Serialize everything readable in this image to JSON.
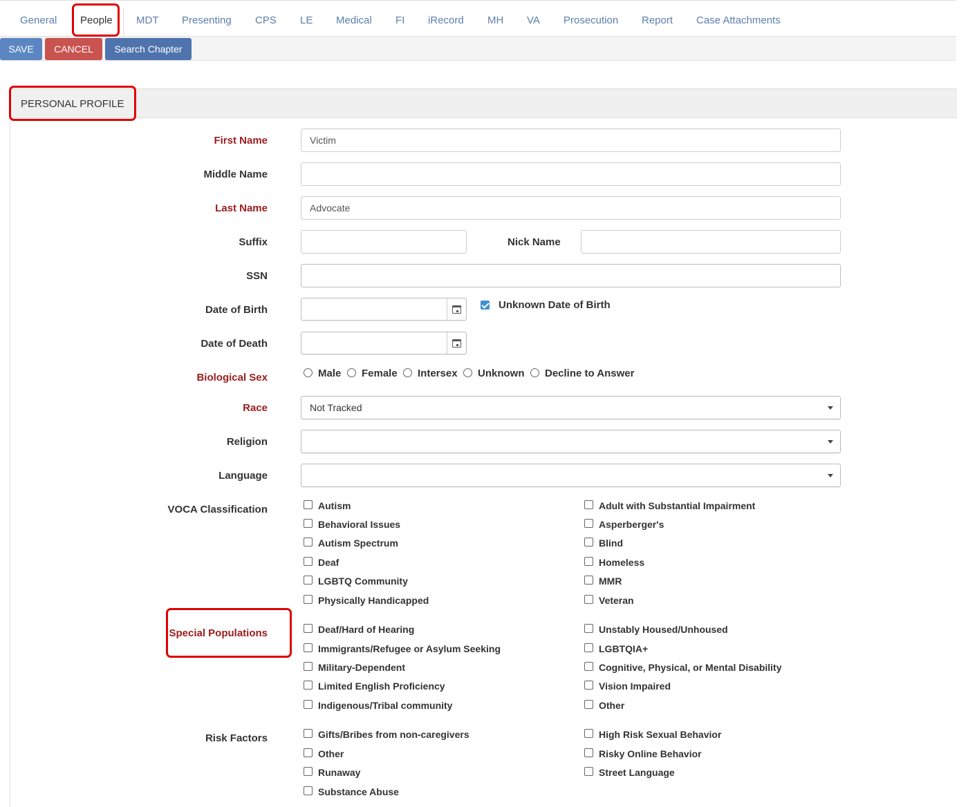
{
  "tabs": [
    {
      "label": "General"
    },
    {
      "label": "People"
    },
    {
      "label": "MDT"
    },
    {
      "label": "Presenting"
    },
    {
      "label": "CPS"
    },
    {
      "label": "LE"
    },
    {
      "label": "Medical"
    },
    {
      "label": "FI"
    },
    {
      "label": "iRecord"
    },
    {
      "label": "MH"
    },
    {
      "label": "VA"
    },
    {
      "label": "Prosecution"
    },
    {
      "label": "Report"
    },
    {
      "label": "Case Attachments"
    }
  ],
  "active_tab": "People",
  "toolbar": {
    "save": "SAVE",
    "cancel": "CANCEL",
    "search_chapter": "Search Chapter"
  },
  "section_title": "PERSONAL PROFILE",
  "form": {
    "first_name": {
      "label": "First Name",
      "value": "Victim",
      "required": true
    },
    "middle_name": {
      "label": "Middle Name",
      "value": ""
    },
    "last_name": {
      "label": "Last Name",
      "value": "Advocate",
      "required": true
    },
    "suffix": {
      "label": "Suffix",
      "value": ""
    },
    "nick_name": {
      "label": "Nick Name",
      "value": ""
    },
    "ssn": {
      "label": "SSN",
      "value": ""
    },
    "dob": {
      "label": "Date of Birth",
      "value": "",
      "unknown_label": "Unknown Date of Birth",
      "unknown_checked": true
    },
    "dod": {
      "label": "Date of Death",
      "value": ""
    },
    "bio_sex": {
      "label": "Biological Sex",
      "required": true,
      "options": [
        "Male",
        "Female",
        "Intersex",
        "Unknown",
        "Decline to Answer"
      ]
    },
    "race": {
      "label": "Race",
      "value": "Not Tracked",
      "required": true
    },
    "religion": {
      "label": "Religion",
      "value": ""
    },
    "language": {
      "label": "Language",
      "value": ""
    },
    "voca": {
      "label": "VOCA Classification",
      "col1": [
        "Autism",
        "Behavioral Issues",
        "Autism Spectrum",
        "Deaf",
        "LGBTQ Community",
        "Physically Handicapped"
      ],
      "col2": [
        "Adult with Substantial Impairment",
        "Asperberger's",
        "Blind",
        "Homeless",
        "MMR",
        "Veteran"
      ]
    },
    "special": {
      "label": "Special Populations",
      "required": true,
      "col1": [
        "Deaf/Hard of Hearing",
        "Immigrants/Refugee or Asylum Seeking",
        "Military-Dependent",
        "Limited English Proficiency",
        "Indigenous/Tribal community"
      ],
      "col2": [
        "Unstably Housed/Unhoused",
        "LGBTQIA+",
        "Cognitive, Physical, or Mental Disability",
        "Vision Impaired",
        "Other"
      ]
    },
    "risk": {
      "label": "Risk Factors",
      "col1": [
        "Gifts/Bribes from non-caregivers",
        "Other",
        "Runaway",
        "Substance Abuse"
      ],
      "col2": [
        "High Risk Sexual Behavior",
        "Risky Online Behavior",
        "Street Language"
      ]
    }
  },
  "colors": {
    "highlight": "#e00000",
    "required_label": "#9a1c1c",
    "tab_link": "#5b7fae",
    "save": "#5b86c2",
    "cancel": "#c9534f",
    "search": "#4e73ad"
  }
}
